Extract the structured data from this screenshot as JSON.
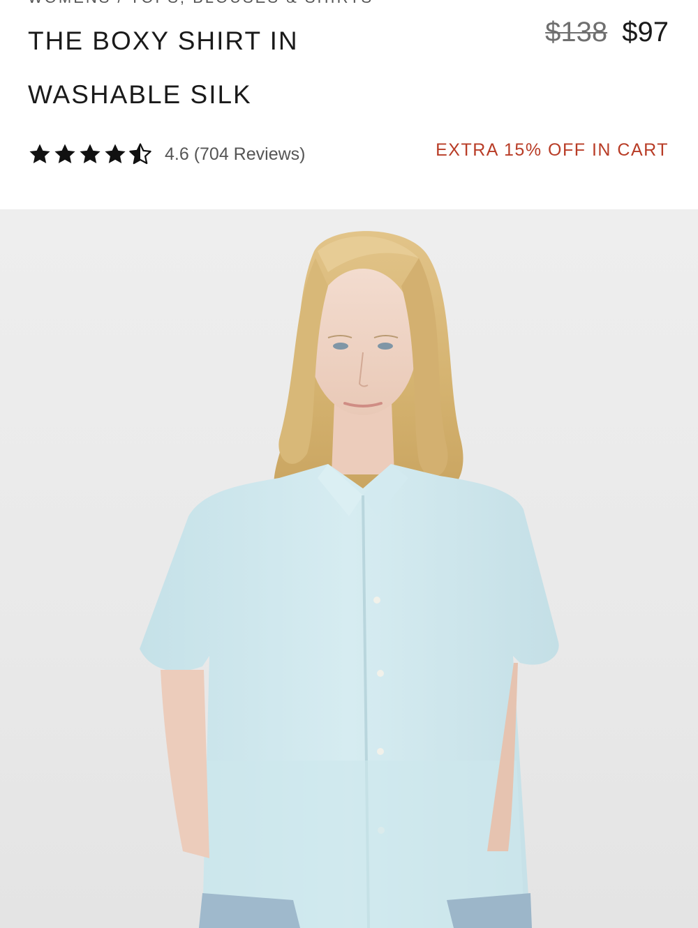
{
  "breadcrumb": "WOMENS / TOPS, BLOUSES & SHIRTS",
  "product": {
    "title": "THE BOXY SHIRT IN WASHABLE SILK",
    "price_original": "$138",
    "price_sale": "$97",
    "rating_value": 4.6,
    "rating_text": "4.6 (704 Reviews)",
    "promo": "EXTRA 15% OFF IN CART"
  },
  "colors": {
    "promo": "#b83c26",
    "shirt": "#cfe8ee",
    "hair": "#d9b978",
    "background": "#eeeeee"
  },
  "image": {
    "subject": "model-wearing-light-blue-boxy-silk-shirt"
  }
}
